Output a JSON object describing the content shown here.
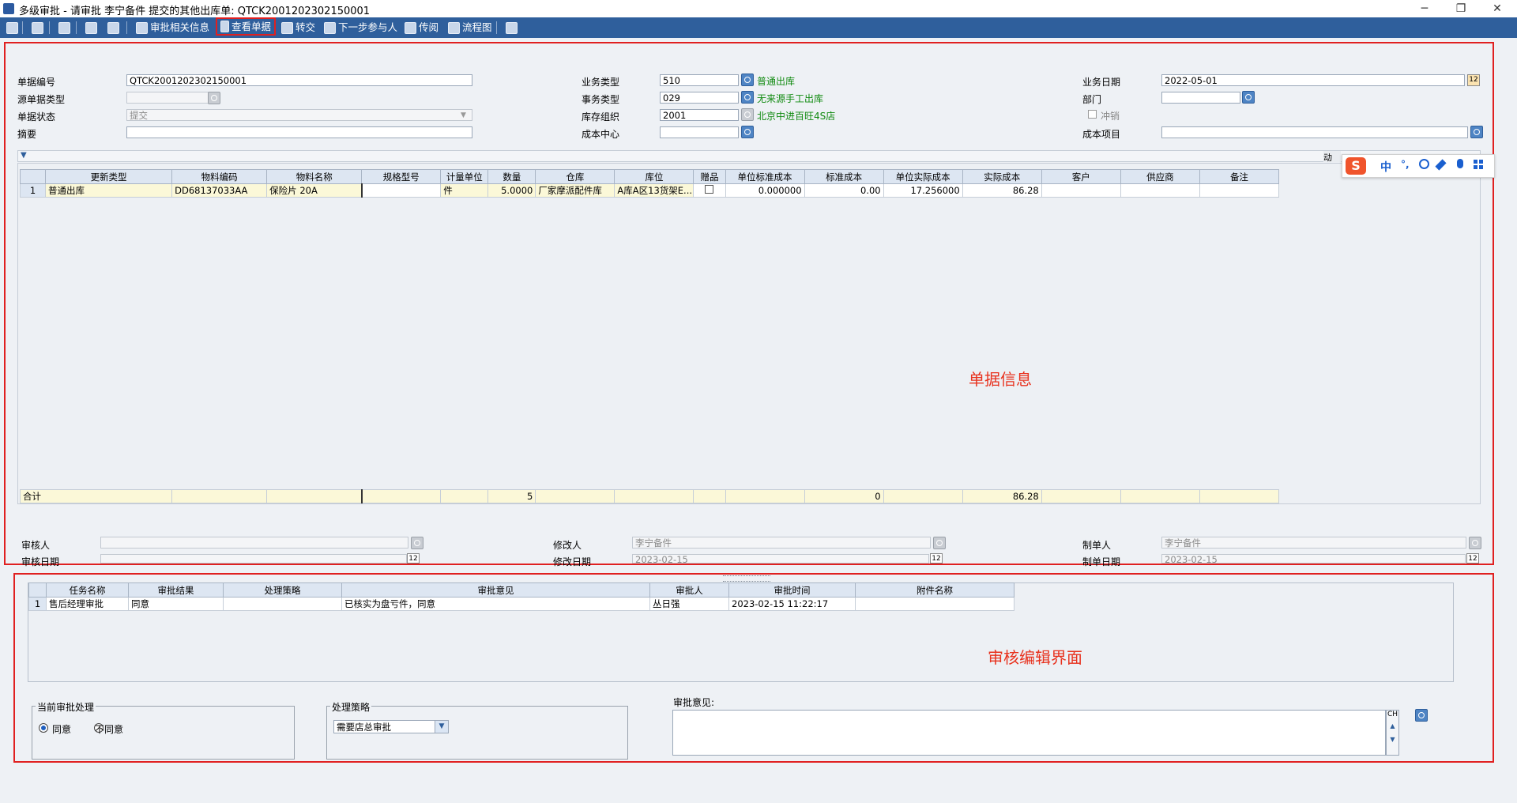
{
  "window": {
    "title": "多级审批 - 请审批 李宁备件 提交的其他出库单: QTCK2001202302150001",
    "minimize": "─",
    "restore": "❐",
    "close": "✕"
  },
  "toolbar": {
    "approval_info": "审批相关信息",
    "view_document": "查看单据",
    "transfer": "转交",
    "next_participant": "下一步参与人",
    "circulate": "传阅",
    "flowchart": "流程图"
  },
  "header": {
    "doc_no_label": "单据编号",
    "doc_no": "QTCK2001202302150001",
    "source_type_label": "源单据类型",
    "source_type": "",
    "status_label": "单据状态",
    "status": "提交",
    "summary_label": "摘要",
    "summary": "",
    "biz_type_label": "业务类型",
    "biz_type": "510",
    "biz_type_name": "普通出库",
    "txn_type_label": "事务类型",
    "txn_type": "029",
    "txn_type_name": "无来源手工出库",
    "inv_org_label": "库存组织",
    "inv_org": "2001",
    "inv_org_name": "北京中进百旺4S店",
    "cost_center_label": "成本中心",
    "cost_center": "",
    "biz_date_label": "业务日期",
    "biz_date": "2022-05-01",
    "dept_label": "部门",
    "dept": "",
    "reverse_label": "冲销",
    "cost_item_label": "成本项目",
    "cost_item": ""
  },
  "grid": {
    "ime_partial": "动",
    "columns": [
      "更新类型",
      "物料编码",
      "物料名称",
      "规格型号",
      "计量单位",
      "数量",
      "仓库",
      "库位",
      "赠品",
      "单位标准成本",
      "标准成本",
      "单位实际成本",
      "实际成本",
      "客户",
      "供应商",
      "备注"
    ],
    "rows": [
      {
        "idx": "1",
        "cells": [
          "普通出库",
          "DD68137033AA",
          "保险片 20A",
          "",
          "件",
          "5.0000",
          "厂家摩派配件库",
          "A库A区13货架E...",
          "",
          "0.000000",
          "0.00",
          "17.256000",
          "86.28",
          "",
          "",
          ""
        ]
      }
    ],
    "total_label": "合计",
    "totals": [
      "",
      "",
      "",
      "",
      "",
      "5",
      "",
      "",
      "",
      "",
      "0",
      "",
      "86.28",
      "",
      "",
      ""
    ]
  },
  "annotations": {
    "doc_info": "单据信息",
    "approval_edit": "审核编辑界面"
  },
  "footer": {
    "auditor_label": "审核人",
    "auditor": "",
    "audit_date_label": "审核日期",
    "audit_date": "",
    "modifier_label": "修改人",
    "modifier": "李宁备件",
    "modify_date_label": "修改日期",
    "modify_date": "2023-02-15",
    "creator_label": "制单人",
    "creator": "李宁备件",
    "create_date_label": "制单日期",
    "create_date": "2023-02-15"
  },
  "approval_grid": {
    "columns": [
      "任务名称",
      "审批结果",
      "处理策略",
      "审批意见",
      "审批人",
      "审批时间",
      "附件名称"
    ],
    "rows": [
      {
        "idx": "1",
        "cells": [
          "售后经理审批",
          "同意",
          "",
          "已核实为盘亏件，同意",
          "丛日强",
          "2023-02-15 11:22:17",
          ""
        ]
      }
    ]
  },
  "approval_form": {
    "current_title": "当前审批处理",
    "agree": "同意",
    "disagree": "不同意",
    "selected": "agree",
    "strategy_title": "处理策略",
    "strategy_value": "需要店总审批",
    "opinion_label": "审批意见:",
    "opinion_value": "",
    "ch_label": "CH"
  },
  "ime": {
    "zh": "中",
    "punct": "°,"
  },
  "colors": {
    "toolbar": "#2f5f9c",
    "highlight": "#e02020",
    "annotation": "#e8321e",
    "ref_name": "#108a10"
  }
}
